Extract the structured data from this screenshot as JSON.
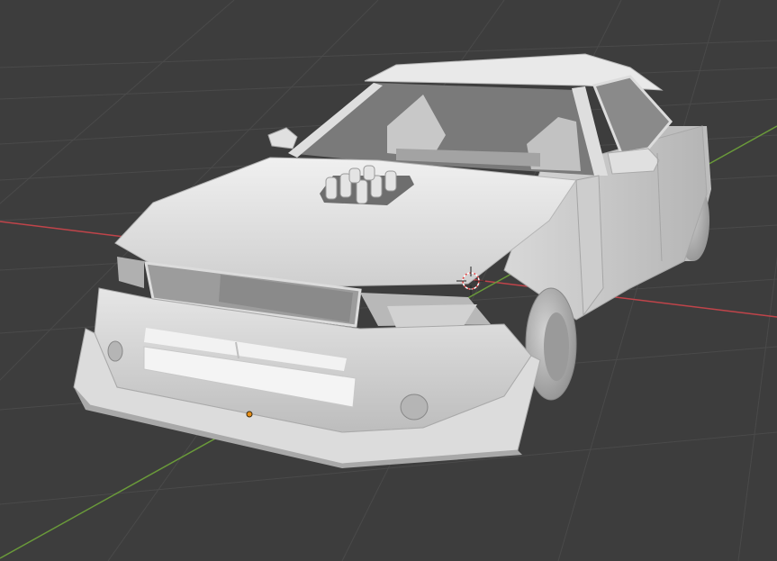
{
  "viewport": {
    "background_color": "#3d3d3d",
    "grid_color": "#4a4a4a",
    "x_axis_color": "#c0444a",
    "y_axis_color": "#6a9a3a",
    "model_color": "#d9d9d9",
    "origin_color": "#e8901a"
  },
  "icons": {
    "cursor": "3d-cursor-icon",
    "origin": "object-origin-icon"
  }
}
